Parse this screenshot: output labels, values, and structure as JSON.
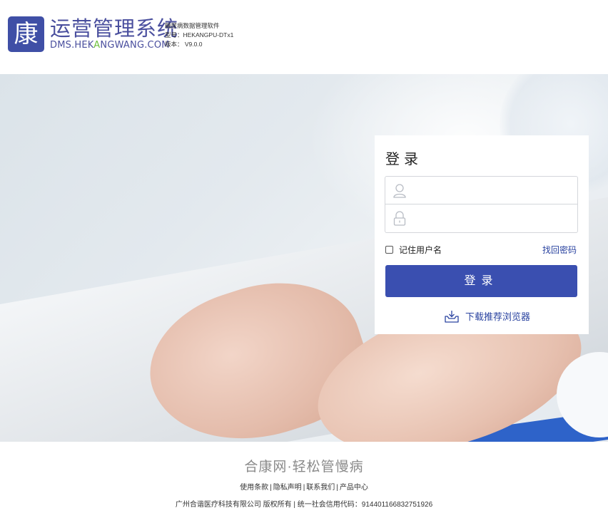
{
  "header": {
    "logo_char": "康",
    "brand_name": "运营管理系统",
    "brand_url_prefix": "DMS.HEK",
    "brand_url_accent": "A",
    "brand_url_suffix": "NGWANG.COM",
    "software_name": "糖尿病数据管理软件",
    "model": "型号：HEKANGPU-DTx1",
    "version": "版本： V9.0.0"
  },
  "login": {
    "title": "登录",
    "username_placeholder": "",
    "password_placeholder": "",
    "remember_label": "记住用户名",
    "forgot_label": "找回密码",
    "submit_label": "登录",
    "download_label": "下载推荐浏览器",
    "icons": {
      "username": "user-icon",
      "password": "lock-icon",
      "download": "download-tray-icon"
    },
    "accent_color": "#3a4fb0"
  },
  "footer": {
    "slogan": "合康网·轻松管慢病",
    "links": [
      "使用条款",
      "隐私声明",
      "联系我们",
      "产品中心"
    ],
    "copyright": "广州合谐医疗科技有限公司 版权所有 | 统一社会信用代码：914401166832751926"
  }
}
